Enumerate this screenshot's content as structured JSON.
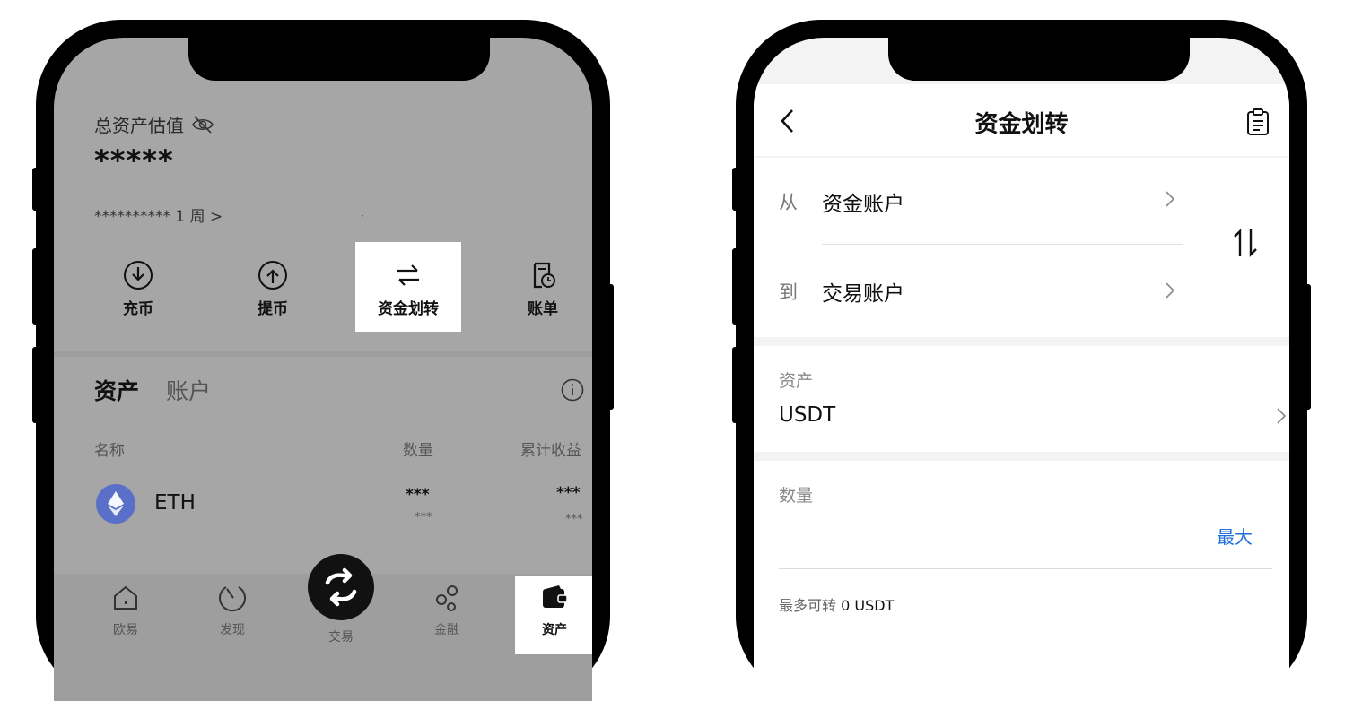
{
  "left_phone": {
    "total_assets_label": "总资产估值",
    "total_assets_value": "*****",
    "sub_line": "********** 1 周 >",
    "sub_dot": "·",
    "actions": [
      {
        "label": "充币",
        "icon": "deposit-icon"
      },
      {
        "label": "提币",
        "icon": "withdraw-icon"
      },
      {
        "label": "资金划转",
        "icon": "transfer-arrows-icon",
        "highlighted": true
      },
      {
        "label": "账单",
        "icon": "bill-icon"
      }
    ],
    "tabs": {
      "assets": "资产",
      "accounts": "账户"
    },
    "columns": {
      "name": "名称",
      "quantity": "数量",
      "earnings": "累计收益"
    },
    "rows": [
      {
        "coin": "ETH",
        "qty_main": "***",
        "qty_sub": "***",
        "earn_main": "***",
        "earn_sub": "***"
      }
    ],
    "tabbar": [
      {
        "label": "欧易",
        "icon": "home-icon"
      },
      {
        "label": "发现",
        "icon": "discover-icon"
      },
      {
        "label": "交易",
        "icon": "trade-swap-icon"
      },
      {
        "label": "金融",
        "icon": "finance-icon"
      },
      {
        "label": "资产",
        "icon": "wallet-icon",
        "highlighted": true
      }
    ]
  },
  "right_phone": {
    "title": "资金划转",
    "from_label": "从",
    "from_value": "资金账户",
    "to_label": "到",
    "to_value": "交易账户",
    "asset_label": "资产",
    "asset_value": "USDT",
    "quantity_label": "数量",
    "max_label": "最大",
    "available_label": "最多可转",
    "available_value": "0 USDT"
  },
  "colors": {
    "accent_blue": "#1e6fd9",
    "overlay_gray": "#a6a6a6",
    "eth_blue": "#5a6fc7"
  }
}
